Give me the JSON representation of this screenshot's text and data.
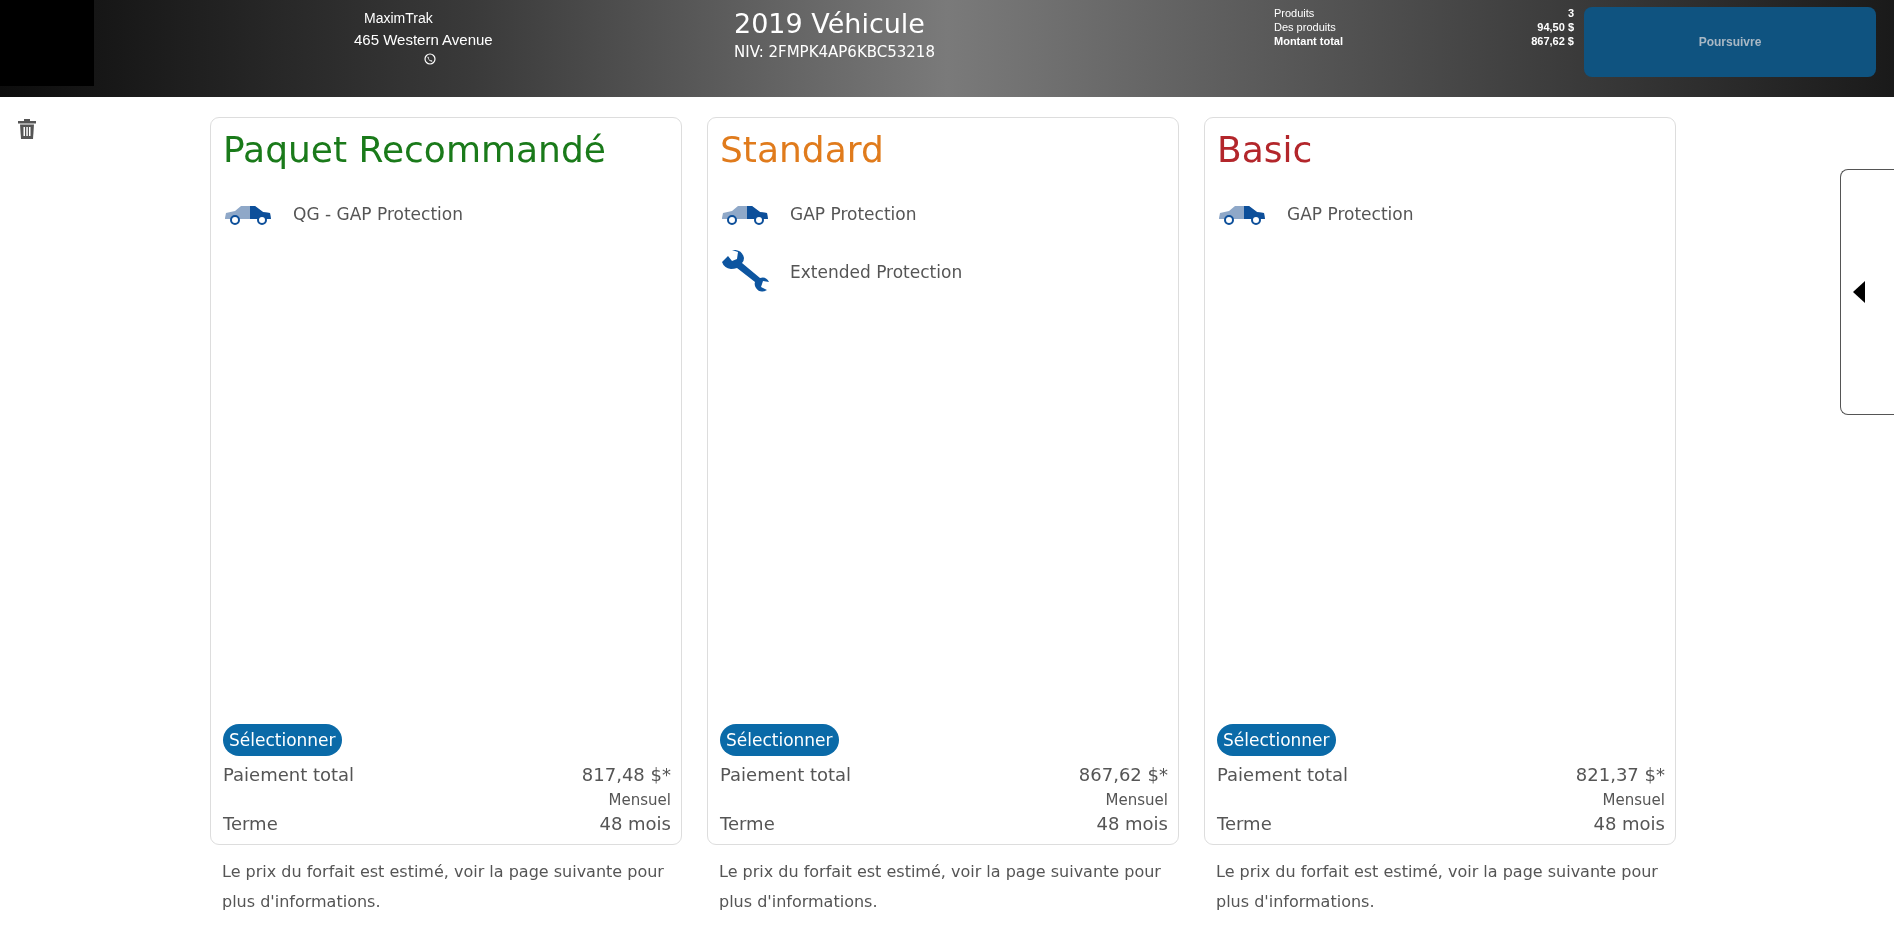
{
  "header": {
    "dealer": {
      "name": "MaximTrak",
      "address": "465 Western Avenue"
    },
    "vehicle": {
      "title": "2019 Véhicule",
      "vin": "NIV: 2FMPK4AP6KBC53218"
    },
    "summary": [
      {
        "label": "Produits",
        "value": "3",
        "bold": false
      },
      {
        "label": "Des produits",
        "value": "94,50 $",
        "bold": false
      },
      {
        "label": "Montant total",
        "value": "867,62 $",
        "bold": true
      }
    ],
    "continue_button": "Poursuivre"
  },
  "packages": [
    {
      "title": "Paquet Recommandé",
      "color": "#1a7a1a",
      "products": [
        {
          "kind": "car",
          "name": "QG - GAP Protection"
        }
      ],
      "select_button": "Sélectionner",
      "total_label": "Paiement total",
      "total": "817,48 $*",
      "frequency": "Mensuel",
      "term_label": "Terme",
      "term": "48 mois",
      "note": "Le prix du forfait est estimé, voir la page suivante pour plus d'informations."
    },
    {
      "title": "Standard",
      "color": "#e07b1c",
      "products": [
        {
          "kind": "car",
          "name": "GAP Protection"
        },
        {
          "kind": "wrench",
          "name": "Extended Protection"
        }
      ],
      "select_button": "Sélectionner",
      "total_label": "Paiement total",
      "total": "867,62 $*",
      "frequency": "Mensuel",
      "term_label": "Terme",
      "term": "48 mois",
      "note": "Le prix du forfait est estimé, voir la page suivante pour plus d'informations."
    },
    {
      "title": "Basic",
      "color": "#b3262b",
      "products": [
        {
          "kind": "car",
          "name": "GAP Protection"
        }
      ],
      "select_button": "Sélectionner",
      "total_label": "Paiement total",
      "total": "821,37 $*",
      "frequency": "Mensuel",
      "term_label": "Terme",
      "term": "48 mois",
      "note": "Le prix du forfait est estimé, voir la page suivante pour plus d'informations."
    }
  ]
}
